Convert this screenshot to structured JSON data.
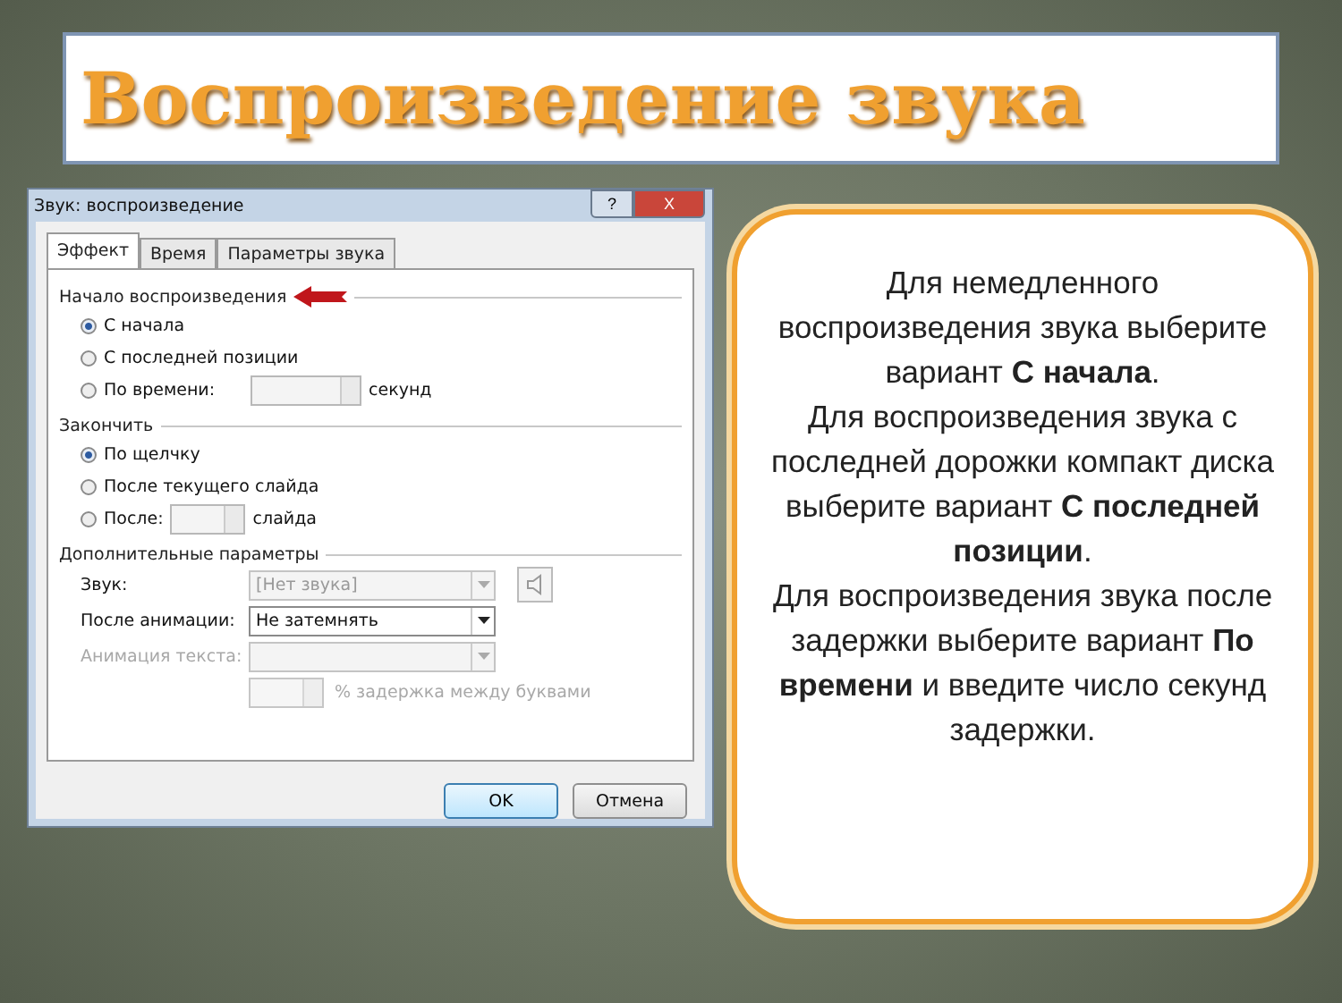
{
  "slide": {
    "title": "Воспроизведение звука"
  },
  "dialog": {
    "title": "Звук: воспроизведение",
    "help": "?",
    "close": "X",
    "tabs": [
      {
        "label": "Эффект",
        "selected": true
      },
      {
        "label": "Время",
        "selected": false
      },
      {
        "label": "Параметры звука",
        "selected": false
      }
    ],
    "groups": [
      {
        "label": "Начало воспроизведения",
        "pointer": true,
        "options": [
          {
            "kind": "plain",
            "label": "С начала",
            "selected": true
          },
          {
            "kind": "plain",
            "label": "С последней позиции",
            "selected": false
          },
          {
            "kind": "spin",
            "label": "По времени:",
            "suffix": "секунд",
            "selected": false
          }
        ]
      },
      {
        "label": "Закончить",
        "pointer": false,
        "options": [
          {
            "kind": "plain",
            "label": "По щелчку",
            "selected": true
          },
          {
            "kind": "plain",
            "label": "После текущего слайда",
            "selected": false
          },
          {
            "kind": "spin",
            "label": "После:",
            "suffix": "слайда",
            "selected": false
          }
        ]
      }
    ],
    "extra": {
      "label": "Дополнительные параметры",
      "rows": [
        {
          "kind": "dropdown",
          "label": "Звук:",
          "value": "[Нет звука]",
          "disabled": true,
          "speaker": true
        },
        {
          "kind": "dropdown",
          "label": "После анимации:",
          "value": "Не затемнять",
          "disabled": false,
          "speaker": false
        },
        {
          "kind": "dropdown",
          "label": "Анимация текста:",
          "disabled": true,
          "speaker": false
        },
        {
          "kind": "spin",
          "suffix": "% задержка между буквами",
          "disabled": true
        }
      ]
    },
    "buttons": [
      {
        "label": "OK",
        "default": true
      },
      {
        "label": "Отмена",
        "default": false
      }
    ]
  },
  "note": {
    "paragraphs": [
      "Для немедленного воспроизведения звука выберите вариант **С начала**.",
      "Для воспроизведения звука с последней дорожки компакт диска выберите вариант **С последней позиции**.",
      "Для воспроизведения звука после задержки выберите вариант **По времени** и введите число секунд задержки."
    ]
  }
}
